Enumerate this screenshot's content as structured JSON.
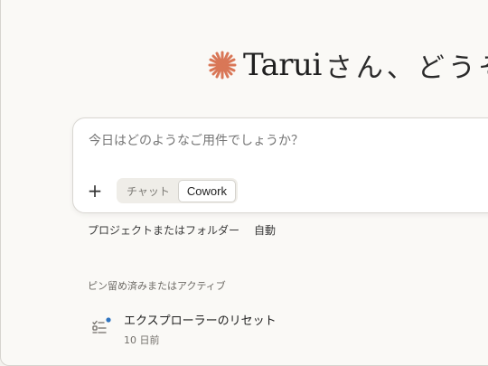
{
  "greeting": {
    "name": "Tarui",
    "rest": "さん、どうぞ"
  },
  "composer": {
    "placeholder": "今日はどのようなご用件でしょうか？",
    "plus_label": "+",
    "modes": [
      "チャット",
      "Cowork"
    ],
    "active_mode": "Cowork"
  },
  "below": {
    "project_label": "プロジェクトまたはフォルダー",
    "auto_label": "自動"
  },
  "pinned": {
    "section_title": "ピン留め済みまたはアクティブ",
    "items": [
      {
        "title": "エクスプローラーのリセット",
        "time": "10 日前"
      }
    ]
  },
  "colors": {
    "accent": "#d97757",
    "status_dot": "#2f74c0"
  },
  "icons": [
    "spark-logo-icon",
    "plus-icon",
    "task-list-icon"
  ]
}
